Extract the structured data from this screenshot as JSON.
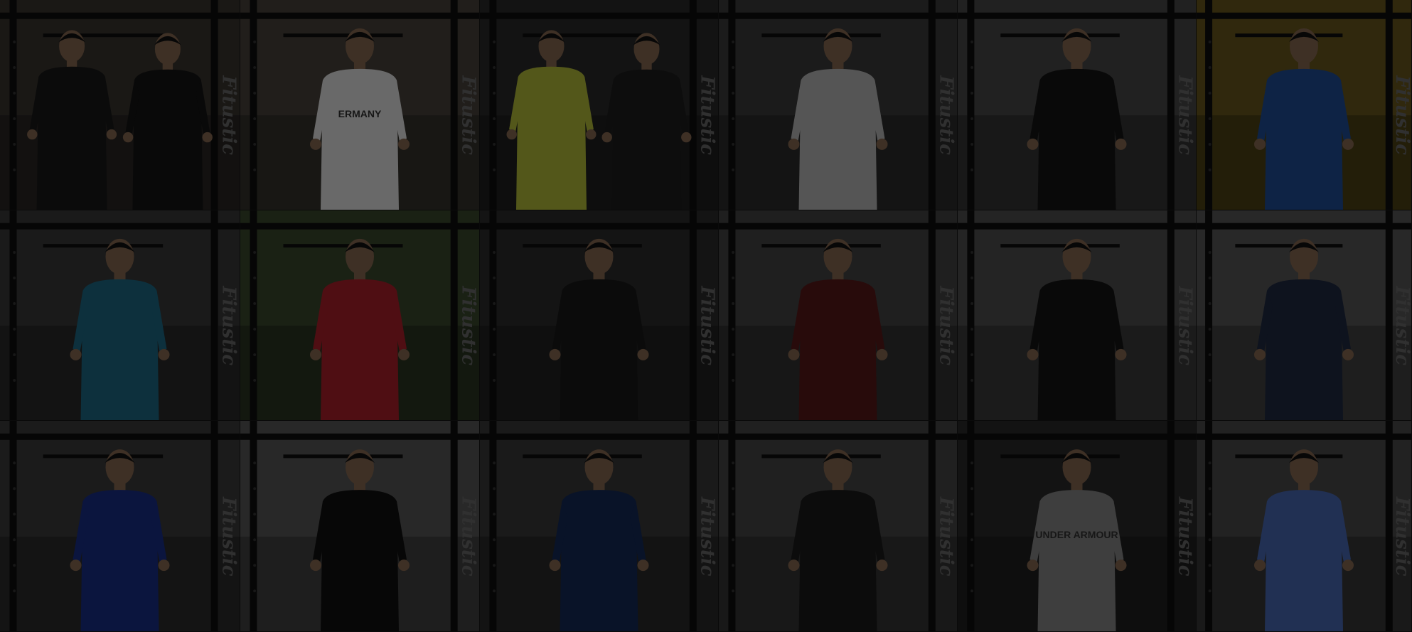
{
  "tiles": [
    {
      "id": "r1c1",
      "shirt_text": "",
      "people": 2,
      "shirts": [
        "#1a1a1a",
        "#141414"
      ],
      "bg": "#3a3530"
    },
    {
      "id": "r1c2",
      "shirt_text": "ERMANY",
      "people": 1,
      "shirts": [
        "#e8e8e8"
      ],
      "bg": "#4a443d"
    },
    {
      "id": "r1c3",
      "shirt_text": "",
      "people": 2,
      "shirts": [
        "#b8c23a",
        "#1e1e1e"
      ],
      "bg": "#2c2c2c"
    },
    {
      "id": "r1c4",
      "shirt_text": "",
      "people": 1,
      "shirts": [
        "#bdbdbd"
      ],
      "bg": "#3c3c3c"
    },
    {
      "id": "r1c5",
      "shirt_text": "",
      "people": 1,
      "shirts": [
        "#151515"
      ],
      "bg": "#4a4a4a"
    },
    {
      "id": "r1c6",
      "shirt_text": "",
      "people": 1,
      "shirts": [
        "#1f4f9a"
      ],
      "bg": "#6a5a1e"
    },
    {
      "id": "r2c1",
      "shirt_text": "",
      "people": 1,
      "shirts": [
        "#1d6a88"
      ],
      "bg": "#3a3a3a"
    },
    {
      "id": "r2c2",
      "shirt_text": "",
      "people": 1,
      "shirts": [
        "#b0202a"
      ],
      "bg": "#3a4a2e"
    },
    {
      "id": "r2c3",
      "shirt_text": "",
      "people": 1,
      "shirts": [
        "#1a1a1a"
      ],
      "bg": "#2e2e2e"
    },
    {
      "id": "r2c4",
      "shirt_text": "",
      "people": 1,
      "shirts": [
        "#5a1a1a"
      ],
      "bg": "#454545"
    },
    {
      "id": "r2c5",
      "shirt_text": "",
      "people": 1,
      "shirts": [
        "#161616"
      ],
      "bg": "#505050"
    },
    {
      "id": "r2c6",
      "shirt_text": "",
      "people": 1,
      "shirts": [
        "#1f2a44"
      ],
      "bg": "#5a5a5a"
    },
    {
      "id": "r3c1",
      "shirt_text": "",
      "people": 1,
      "shirts": [
        "#1a2f8a"
      ],
      "bg": "#3c3c3c"
    },
    {
      "id": "r3c2",
      "shirt_text": "",
      "people": 1,
      "shirts": [
        "#111111"
      ],
      "bg": "#5a5a5a"
    },
    {
      "id": "r3c3",
      "shirt_text": "",
      "people": 1,
      "shirts": [
        "#142a5a"
      ],
      "bg": "#3a3a3a"
    },
    {
      "id": "r3c4",
      "shirt_text": "",
      "people": 1,
      "shirts": [
        "#1b1b1b"
      ],
      "bg": "#484848"
    },
    {
      "id": "r3c5",
      "shirt_text": "UNDER ARMOUR",
      "people": 1,
      "shirts": [
        "#8a8a8a"
      ],
      "bg": "#2a2a2a"
    },
    {
      "id": "r3c6",
      "shirt_text": "",
      "people": 1,
      "shirts": [
        "#4a6ab8"
      ],
      "bg": "#4c4c4c"
    }
  ],
  "brand_mark": "Fitustic",
  "colors": {
    "overlay": "#000000",
    "skin": "#8a6a52",
    "rack": "#0e0e0e"
  }
}
